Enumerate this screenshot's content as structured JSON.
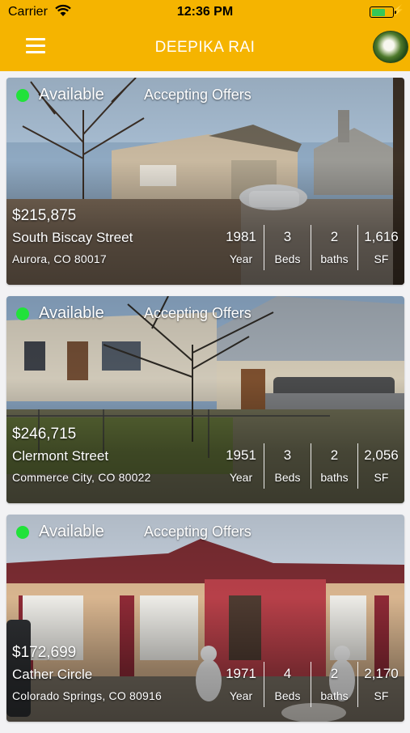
{
  "status_bar": {
    "carrier": "Carrier",
    "time": "12:36 PM",
    "battery_level": 0.65
  },
  "nav": {
    "title": "DEEPIKA RAI"
  },
  "listings": [
    {
      "status": "Available",
      "offers": "Accepting Offers",
      "price": "$215,875",
      "street": "South Biscay Street",
      "city": "Aurora, CO 80017",
      "year": "1981",
      "year_label": "Year",
      "beds": "3",
      "beds_label": "Beds",
      "baths": "2",
      "baths_label": "baths",
      "sf": "1,616",
      "sf_label": "SF"
    },
    {
      "status": "Available",
      "offers": "Accepting Offers",
      "price": "$246,715",
      "street": "Clermont Street",
      "city": "Commerce City, CO 80022",
      "year": "1951",
      "year_label": "Year",
      "beds": "3",
      "beds_label": "Beds",
      "baths": "2",
      "baths_label": "baths",
      "sf": "2,056",
      "sf_label": "SF"
    },
    {
      "status": "Available",
      "offers": "Accepting Offers",
      "price": "$172,699",
      "street": "Cather Circle",
      "city": "Colorado Springs, CO 80916",
      "year": "1971",
      "year_label": "Year",
      "beds": "4",
      "beds_label": "Beds",
      "baths": "2",
      "baths_label": "baths",
      "sf": "2,170",
      "sf_label": "SF"
    }
  ],
  "colors": {
    "header": "#f5b400",
    "available_dot": "#21e23a",
    "battery": "#35c759"
  }
}
